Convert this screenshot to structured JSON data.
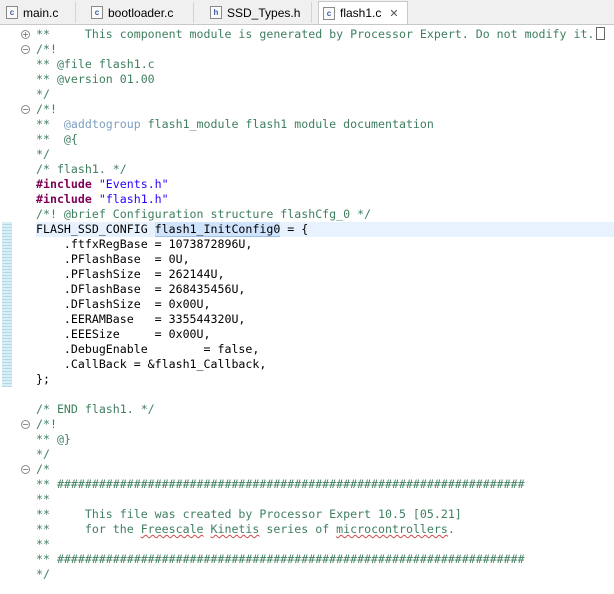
{
  "tabs": [
    {
      "icon": "c-file-icon",
      "glyph": "c",
      "label": "main.c"
    },
    {
      "icon": "c-file-icon",
      "glyph": "c",
      "label": "bootloader.c"
    },
    {
      "icon": "h-file-icon",
      "glyph": "h",
      "label": "SSD_Types.h"
    },
    {
      "icon": "c-file-icon",
      "glyph": "c",
      "label": "flash1.c",
      "active": true,
      "close": "✕"
    }
  ],
  "fold_marks": {
    "expand": "+",
    "collapse": "−"
  },
  "code": {
    "l1": "**     This component module is generated by Processor Expert. Do not modify it.",
    "l2": "/*!",
    "l3": "** @file flash1.c",
    "l4": "** @version 01.00",
    "l5": "*/",
    "l6": "/*!",
    "l7a": "**  ",
    "l7b": "@addtogroup",
    "l7c": " flash1_module flash1 module documentation",
    "l8": "**  @{",
    "l9": "*/",
    "l10": "/* flash1. */",
    "l11_kw": "#include",
    "l11_str": "\"Events.h\"",
    "l12_kw": "#include",
    "l12_str": "\"flash1.h\"",
    "l13": "/*! @brief Configuration structure flashCfg_0 */",
    "l14_type": "FLASH_SSD_CONFIG ",
    "l14_sel": "flash1_InitConfig0",
    "l14_rest": " = {",
    "l15": "    .ftfxRegBase = 1073872896U,",
    "l16": "    .PFlashBase  = 0U,",
    "l17": "    .PFlashSize  = 262144U,",
    "l18": "    .DFlashBase  = 268435456U,",
    "l19": "    .DFlashSize  = 0x00U,",
    "l20": "    .EERAMBase   = 335544320U,",
    "l21": "    .EEESize     = 0x00U,",
    "l22": "    .DebugEnable        = false,",
    "l23": "    .CallBack = &flash1_Callback,",
    "l24": "};",
    "l25": "",
    "l26": "/* END flash1. */",
    "l27": "/*!",
    "l28": "** @}",
    "l29": "*/",
    "l30": "/*",
    "l31": "** ###################################################################",
    "l32": "**",
    "l33": "**     This file was created by Processor Expert 10.5 [05.21]",
    "l34a": "**     for the ",
    "l34b": "Freescale",
    "l34c": " ",
    "l34d": "Kinetis",
    "l34e": " series of ",
    "l34f": "microcontrollers",
    "l34g": ".",
    "l35": "**",
    "l36": "** ###################################################################",
    "l37": "*/"
  }
}
